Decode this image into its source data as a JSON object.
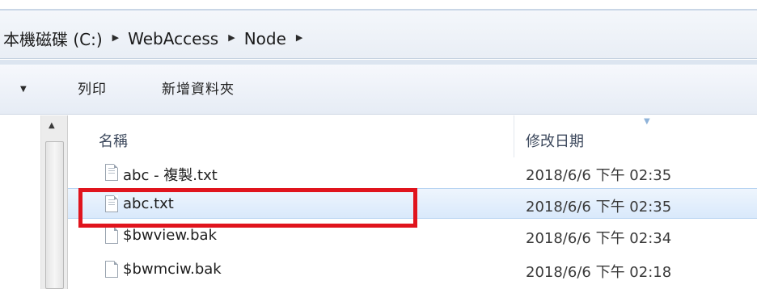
{
  "breadcrumb": {
    "items": [
      "本機磁碟 (C:)",
      "WebAccess",
      "Node"
    ]
  },
  "toolbar": {
    "print_label": "列印",
    "new_folder_label": "新增資料夾"
  },
  "columns": {
    "name": "名稱",
    "date_modified": "修改日期"
  },
  "files": [
    {
      "name": "abc - 複製.txt",
      "date": "2018/6/6 下午 02:35",
      "icon": "text-file-icon",
      "selected": false
    },
    {
      "name": "abc.txt",
      "date": "2018/6/6 下午 02:35",
      "icon": "text-file-icon",
      "selected": true
    },
    {
      "name": "$bwview.bak",
      "date": "2018/6/6 下午 02:34",
      "icon": "file-icon",
      "selected": false
    },
    {
      "name": "$bwmciw.bak",
      "date": "2018/6/6 下午 02:18",
      "icon": "file-icon",
      "selected": false
    }
  ],
  "colors": {
    "highlight": "#e0141d",
    "selection": "#d9e9fb"
  }
}
